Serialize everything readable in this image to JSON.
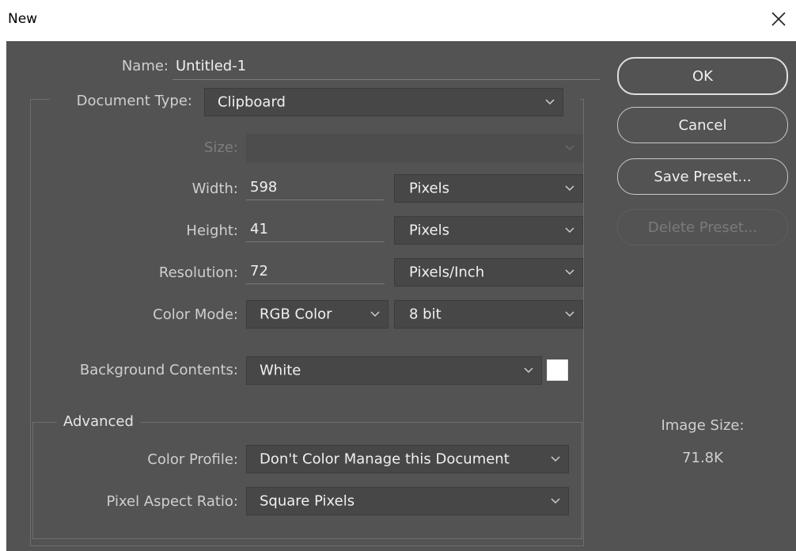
{
  "window": {
    "title": "New"
  },
  "form": {
    "name_label": "Name:",
    "name_value": "Untitled-1",
    "document_type_label": "Document Type:",
    "document_type_value": "Clipboard",
    "size_label": "Size:",
    "size_value": "",
    "width_label": "Width:",
    "width_value": "598",
    "width_unit": "Pixels",
    "height_label": "Height:",
    "height_value": "41",
    "height_unit": "Pixels",
    "resolution_label": "Resolution:",
    "resolution_value": "72",
    "resolution_unit": "Pixels/Inch",
    "color_mode_label": "Color Mode:",
    "color_mode_value": "RGB Color",
    "bit_depth_value": "8 bit",
    "background_label": "Background Contents:",
    "background_value": "White",
    "background_swatch_color": "#ffffff"
  },
  "advanced": {
    "legend": "Advanced",
    "color_profile_label": "Color Profile:",
    "color_profile_value": "Don't Color Manage this Document",
    "pixel_aspect_label": "Pixel Aspect Ratio:",
    "pixel_aspect_value": "Square Pixels"
  },
  "buttons": {
    "ok": "OK",
    "cancel": "Cancel",
    "save_preset": "Save Preset...",
    "delete_preset": "Delete Preset..."
  },
  "image_size": {
    "label": "Image Size:",
    "value": "71.8K"
  },
  "icons": {
    "close": "close-icon",
    "dropdown": "chevron-down-icon"
  },
  "colors": {
    "panel_bg": "#535353",
    "field_bg": "#474747",
    "text": "#f0f0f0"
  }
}
